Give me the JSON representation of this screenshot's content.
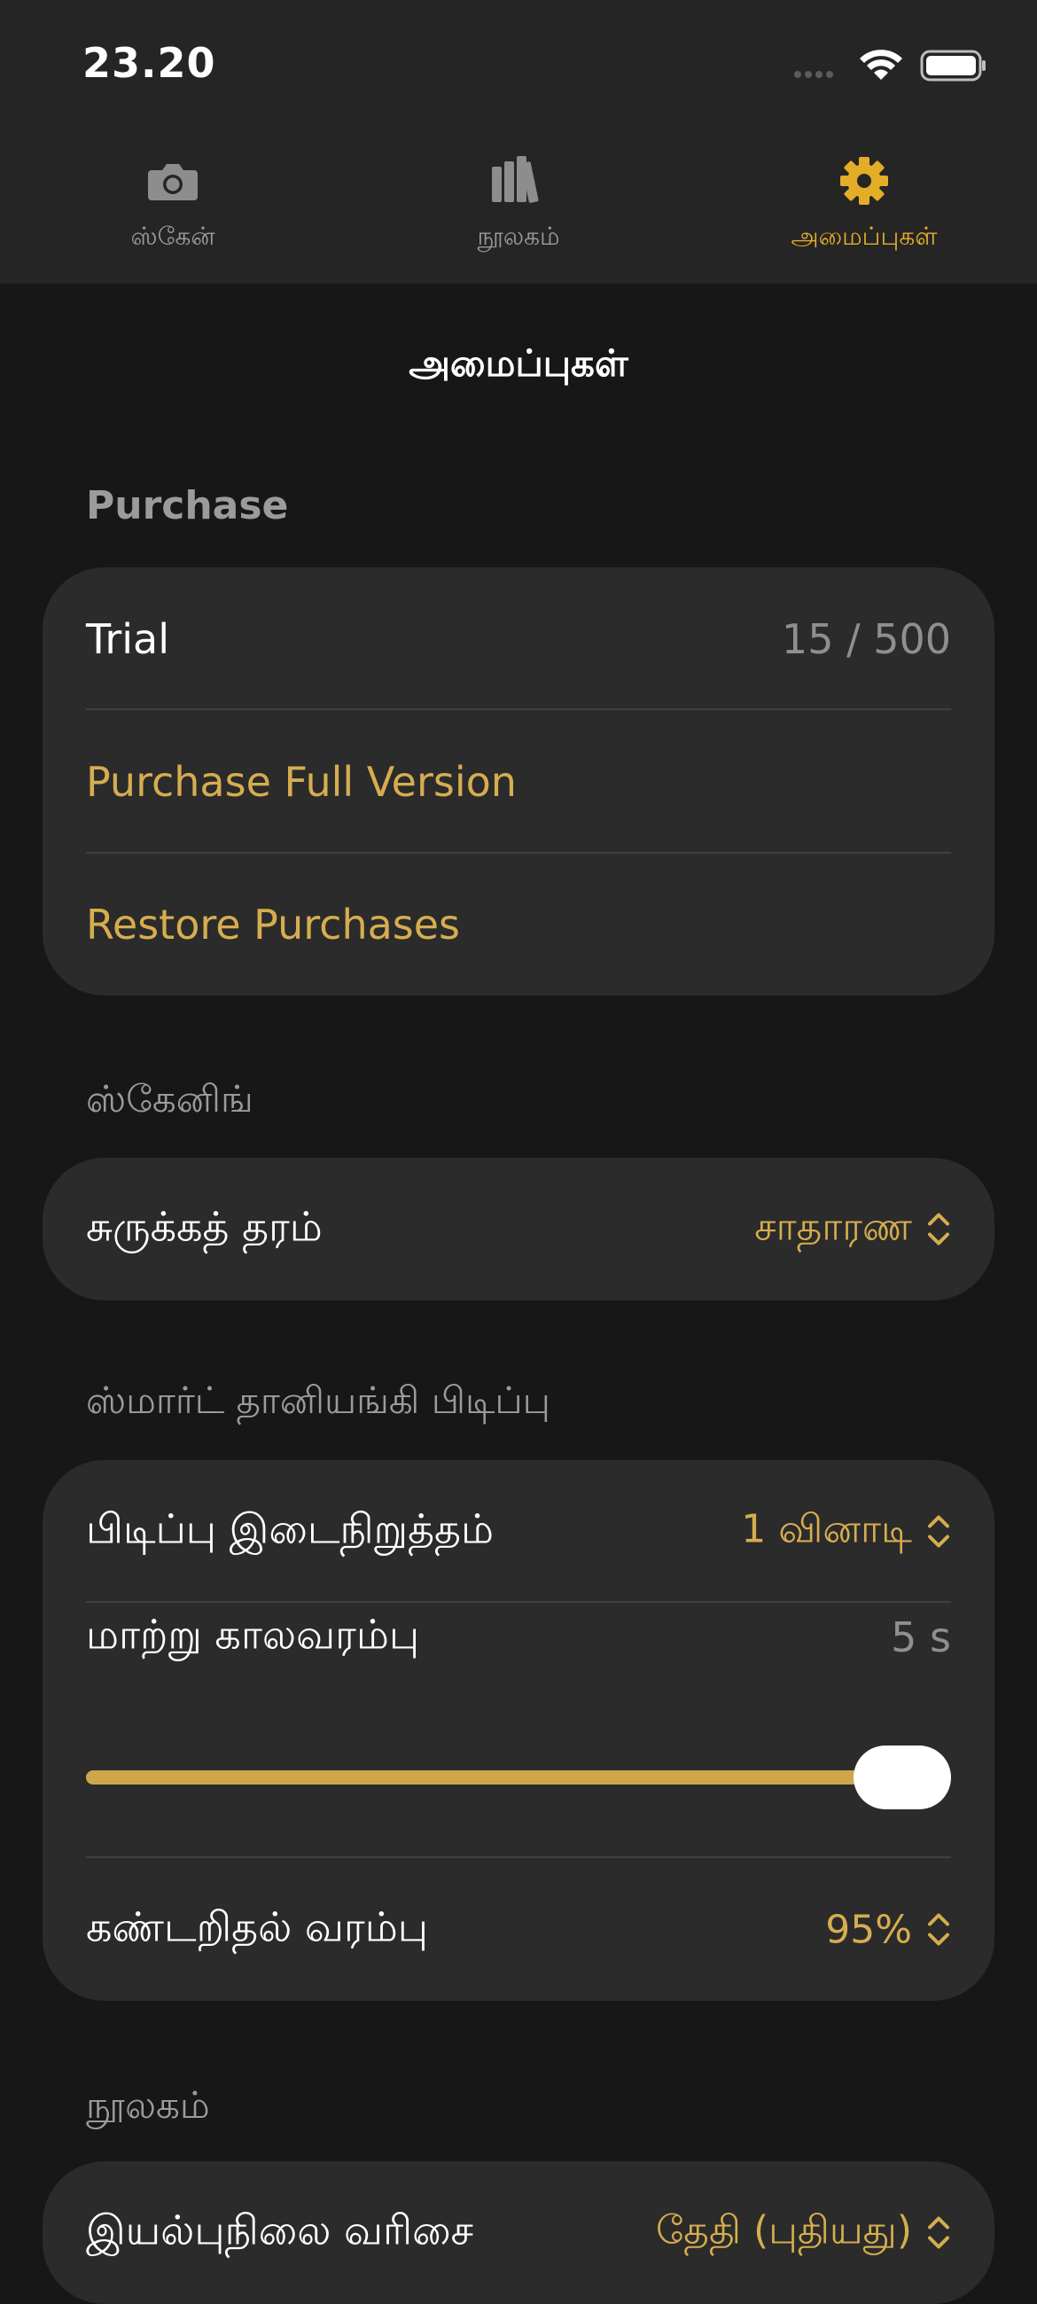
{
  "status_bar": {
    "time": "23.20"
  },
  "tabs": [
    {
      "label": "ஸ்கேன்",
      "icon": "camera-icon",
      "active": false
    },
    {
      "label": "நூலகம்",
      "icon": "library-icon",
      "active": false
    },
    {
      "label": "அமைப்புகள்",
      "icon": "gear-icon",
      "active": true
    }
  ],
  "page": {
    "title": "அமைப்புகள்"
  },
  "purchase": {
    "header": "Purchase",
    "trial_label": "Trial",
    "trial_value": "15 / 500",
    "purchase_full": "Purchase Full Version",
    "restore": "Restore Purchases"
  },
  "scanning": {
    "header": "ஸ்கேனிங்",
    "compression_label": "சுருக்கத் தரம்",
    "compression_value": "சாதாரண"
  },
  "smart_capture": {
    "header": "ஸ்மார்ட் தானியங்கி பிடிப்பு",
    "capture_pause_label": "பிடிப்பு இடைநிறுத்தம்",
    "capture_pause_value": "1 வினாடி",
    "timeout_label": "மாற்று காலவரம்பு",
    "timeout_value": "5 s",
    "timeout_slider_fraction": 1.0,
    "detection_label": "கண்டறிதல் வரம்பு",
    "detection_value": "95%"
  },
  "library": {
    "header": "நூலகம்",
    "sort_label": "இயல்புநிலை வரிசை",
    "sort_value": "தேதி (புதியது)"
  },
  "colors": {
    "accent": "#e4ad28",
    "link": "#d6ad4f",
    "background": "#171717",
    "card": "#2b2b2b",
    "header": "#252525"
  }
}
